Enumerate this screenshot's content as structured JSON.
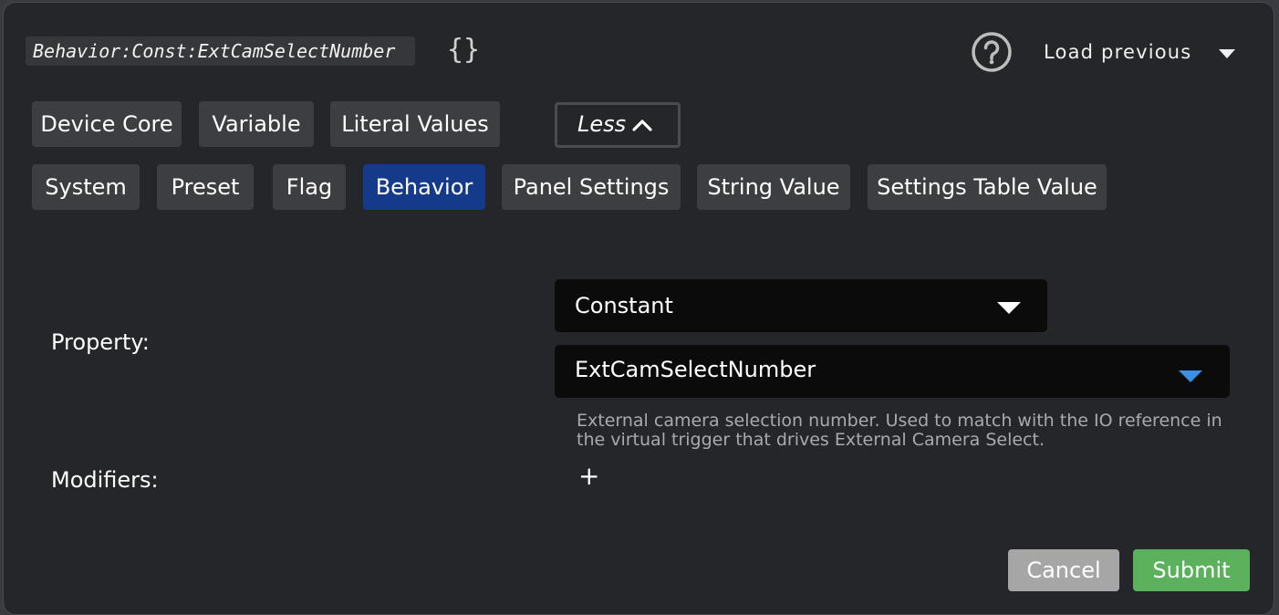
{
  "header": {
    "expression": "Behavior:Const:ExtCamSelectNumber",
    "braces": "{}",
    "help_icon": "help-circle-icon",
    "load_previous_label": "Load previous"
  },
  "category_row1": [
    "Device Core",
    "Variable",
    "Literal Values"
  ],
  "less_toggle": {
    "label": "Less"
  },
  "category_row2": [
    "System",
    "Preset",
    "Flag",
    "Behavior",
    "Panel Settings",
    "String Value",
    "Settings Table Value"
  ],
  "active_category": "Behavior",
  "form": {
    "property_label": "Property:",
    "property_type_value": "Constant",
    "property_name_value": "ExtCamSelectNumber",
    "description": "External camera selection number. Used to match with the IO reference in the virtual trigger that drives External Camera Select.",
    "modifiers_label": "Modifiers:",
    "add_modifier": "+"
  },
  "footer": {
    "cancel_label": "Cancel",
    "submit_label": "Submit"
  },
  "colors": {
    "dialog_bg": "#25262a",
    "button_bg": "#3d3e42",
    "active_button": "#163a8a",
    "select_bg": "#0b0b0c",
    "accent_caret": "#3d8fe6",
    "cancel": "#a6a6a6",
    "submit": "#5cb15c"
  }
}
